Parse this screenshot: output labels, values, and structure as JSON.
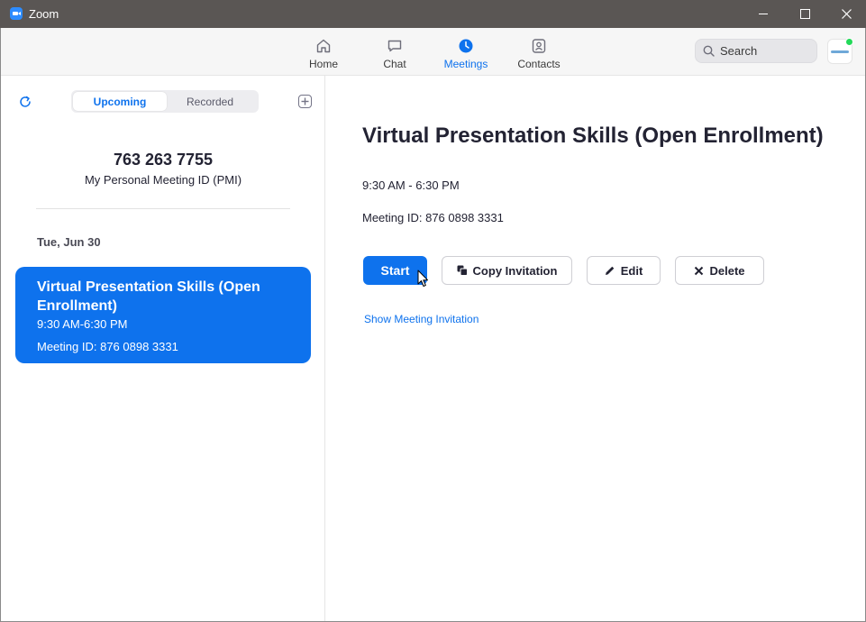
{
  "window": {
    "title": "Zoom",
    "controls": [
      "minimize",
      "maximize",
      "close"
    ]
  },
  "nav": {
    "tabs": [
      {
        "label": "Home",
        "icon": "home-icon",
        "active": false
      },
      {
        "label": "Chat",
        "icon": "chat-icon",
        "active": false
      },
      {
        "label": "Meetings",
        "icon": "clock-icon",
        "active": true
      },
      {
        "label": "Contacts",
        "icon": "contacts-icon",
        "active": false
      }
    ],
    "search": {
      "placeholder": "Search",
      "value": ""
    },
    "avatar": {
      "status": "online",
      "status_color": "#23d959"
    }
  },
  "left": {
    "segments": {
      "upcoming": "Upcoming",
      "recorded": "Recorded",
      "selected": "Upcoming"
    },
    "pmi": {
      "number": "763 263 7755",
      "label": "My Personal Meeting ID (PMI)"
    },
    "date_header": "Tue, Jun 30",
    "meetings": [
      {
        "title": "Virtual Presentation Skills (Open Enrollment)",
        "time": "9:30 AM-6:30 PM",
        "meeting_id": "Meeting ID: 876 0898 3331",
        "selected": true
      }
    ]
  },
  "detail": {
    "title": "Virtual Presentation Skills (Open Enrollment)",
    "time": "9:30 AM - 6:30 PM",
    "meeting_id": "Meeting ID: 876 0898 3331",
    "buttons": {
      "start": "Start",
      "copy_invitation": "Copy Invitation",
      "edit": "Edit",
      "delete": "Delete"
    },
    "show_invitation": "Show Meeting Invitation"
  },
  "colors": {
    "accent": "#0e72ed",
    "titlebar": "#5a5654",
    "navbar": "#f6f6f6"
  }
}
